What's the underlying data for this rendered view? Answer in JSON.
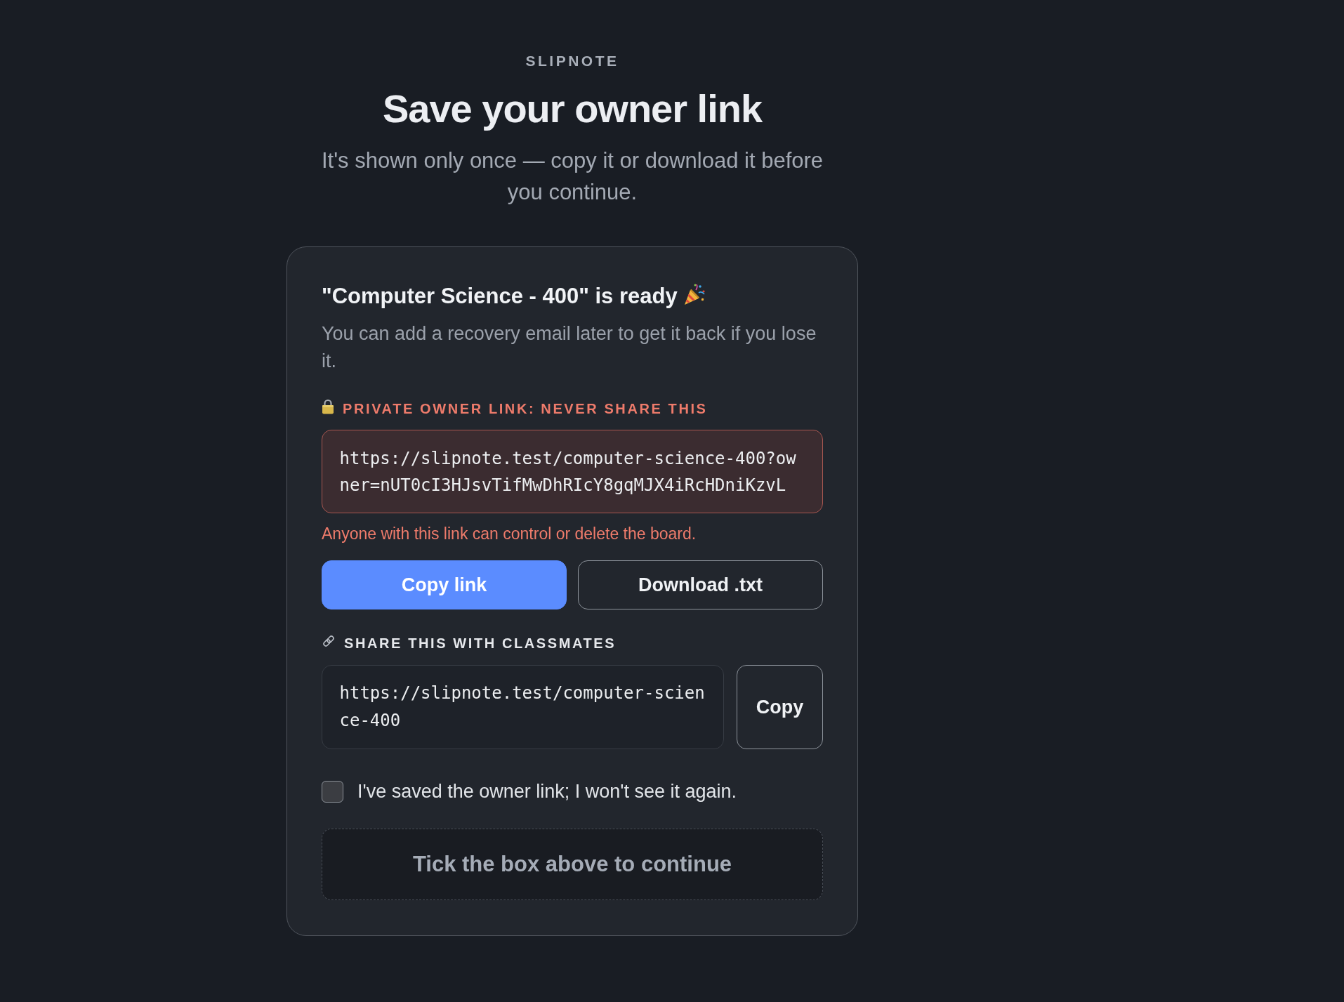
{
  "brand": "SLIPNOTE",
  "title": "Save your owner link",
  "subtitle": "It's shown only once — copy it or download it before you continue.",
  "card": {
    "heading": "\"Computer Science - 400\" is ready",
    "description": "You can add a recovery email later to get it back if you lose it.",
    "owner_link": {
      "label": "PRIVATE OWNER LINK: NEVER SHARE THIS",
      "value": "https://slipnote.test/computer-science-400?owner=nUT0cI3HJsvTifMwDhRIcY8gqMJX4iRcHDniKzvL",
      "warning": "Anyone with this link can control or delete the board.",
      "buttons": [
        {
          "label": "Copy link",
          "kind": "primary"
        },
        {
          "label": "Download .txt",
          "kind": "secondary"
        }
      ]
    },
    "share_link": {
      "label": "SHARE THIS WITH CLASSMATES",
      "value": "https://slipnote.test/computer-science-400",
      "button": "Copy"
    },
    "confirm": {
      "label": "I've saved the owner link; I won't see it again.",
      "checked": false
    },
    "continue_button": {
      "label": "Tick the box above to continue",
      "disabled": true
    }
  }
}
